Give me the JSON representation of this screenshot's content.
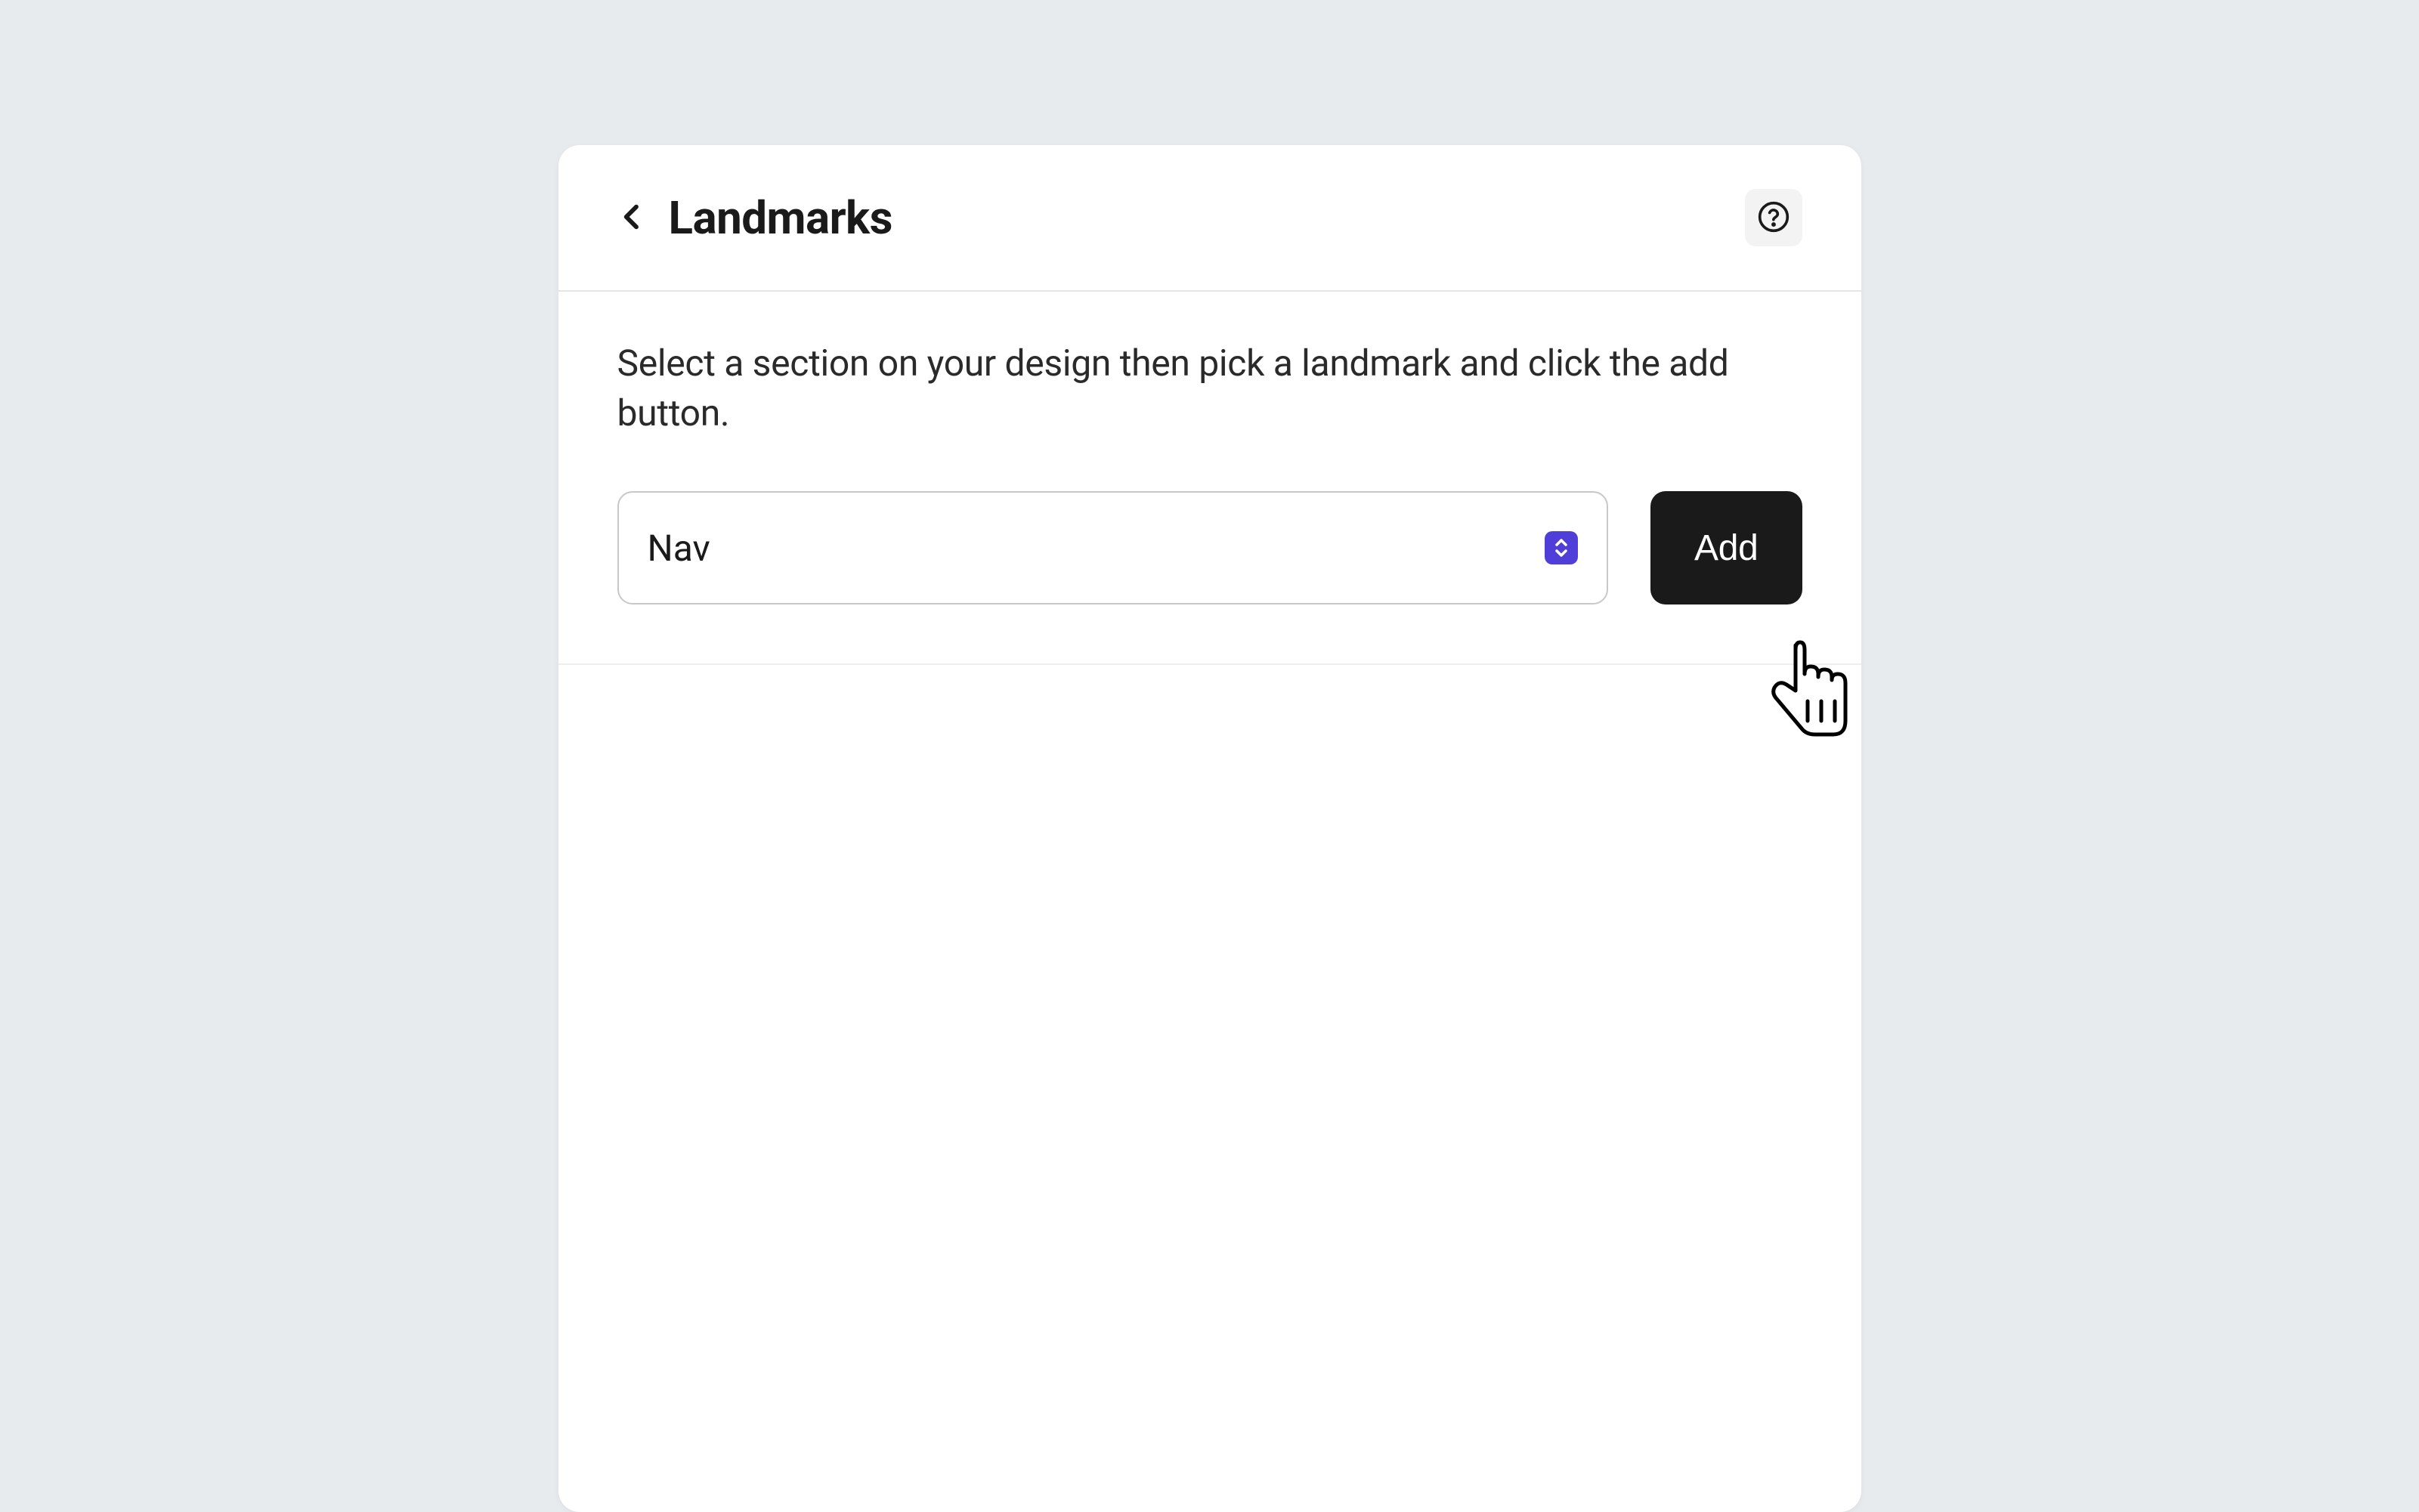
{
  "header": {
    "title": "Landmarks"
  },
  "body": {
    "instruction": "Select a section on your design then pick a landmark and click the add button.",
    "select": {
      "value": "Nav"
    },
    "add_button_label": "Add"
  }
}
